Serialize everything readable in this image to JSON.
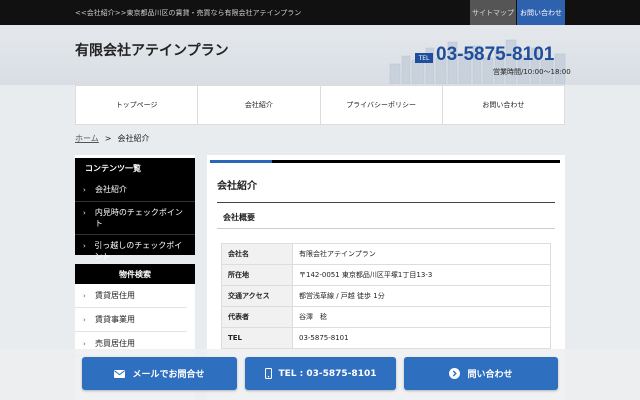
{
  "topbar": {
    "breadcrumb_text": "<<会社紹介>>東京都品川区の賃貸・売買なら有限会社アテインプラン",
    "sitemap_label": "サイトマップ",
    "contact_label": "お問い合わせ"
  },
  "header": {
    "company_name": "有限会社アテインプラン",
    "tel_badge": "TEL",
    "tel_number": "03-5875-8101",
    "hours": "営業時間/10:00～18:00"
  },
  "gnav": {
    "items": [
      "トップページ",
      "会社紹介",
      "プライバシーポリシー",
      "お問い合わせ"
    ]
  },
  "breadcrumb": {
    "home": "ホーム",
    "separator": ">",
    "current": "会社紹介"
  },
  "sidebar": {
    "contents_title": "コンテンツ一覧",
    "contents_items": [
      "会社紹介",
      "内見時のチェックポイント",
      "引っ越しのチェックポイント"
    ],
    "search_title": "物件検索",
    "search_items": [
      "賃貸居住用",
      "賃貸事業用",
      "売買居住用"
    ]
  },
  "main": {
    "page_title": "会社紹介",
    "section_title": "会社概要",
    "table": [
      {
        "key": "会社名",
        "value": "有限会社アテインプラン"
      },
      {
        "key": "所在地",
        "value": "〒142-0051 東京都品川区平塚1丁目13-3"
      },
      {
        "key": "交通アクセス",
        "value": "都営浅草線 / 戸越 徒歩 1分"
      },
      {
        "key": "代表者",
        "value": "谷澤　稔"
      },
      {
        "key": "TEL",
        "value": "03-5875-8101"
      }
    ]
  },
  "cta": {
    "mail_label": "メールでお問合せ",
    "tel_label": "TEL : 03-5875-8101",
    "inquiry_label": "問い合わせ"
  },
  "colors": {
    "accent_blue": "#2f6fbf",
    "brand_blue": "#1f4e9c",
    "topbar_black": "#111111"
  }
}
